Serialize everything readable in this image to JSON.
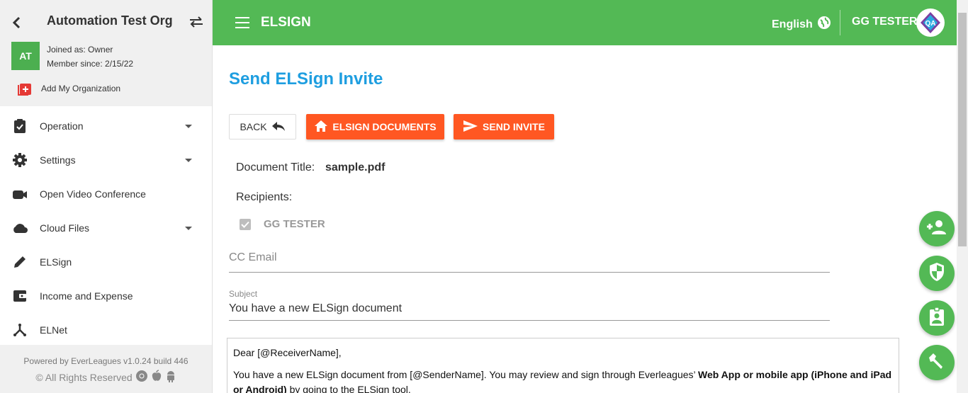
{
  "sidebar": {
    "org_name": "Automation Test Org",
    "avatar_initials": "AT",
    "joined_as": "Joined as: Owner",
    "member_since": "Member since: 2/15/22",
    "add_org_label": "Add My Organization",
    "items": [
      {
        "label": "Operation",
        "icon": "clipboard-check-icon",
        "has_caret": true
      },
      {
        "label": "Settings",
        "icon": "gear-icon",
        "has_caret": true
      },
      {
        "label": "Open Video Conference",
        "icon": "video-camera-icon",
        "has_caret": false
      },
      {
        "label": "Cloud Files",
        "icon": "cloud-icon",
        "has_caret": true
      },
      {
        "label": "ELSign",
        "icon": "pencil-icon",
        "has_caret": false
      },
      {
        "label": "Income and Expense",
        "icon": "wallet-icon",
        "has_caret": false
      },
      {
        "label": "ELNet",
        "icon": "network-icon",
        "has_caret": false
      }
    ],
    "footer": {
      "powered_by": "Powered by EverLeagues v1.0.24 build 446",
      "rights": "© All Rights Reserved"
    }
  },
  "topbar": {
    "app_title": "ELSIGN",
    "language": "English",
    "user_name": "GG TESTER",
    "user_avatar_text": "QA"
  },
  "main": {
    "title": "Send ELSign Invite",
    "buttons": {
      "back": "BACK",
      "documents": "ELSIGN DOCUMENTS",
      "send": "SEND INVITE"
    },
    "document_title_label": "Document Title:",
    "document_title_value": "sample.pdf",
    "recipients_label": "Recipients:",
    "recipients": [
      {
        "name": "GG TESTER",
        "checked": true
      }
    ],
    "cc_email_placeholder": "CC Email",
    "cc_email_value": "",
    "subject_label": "Subject",
    "subject_value": "You have a new ELSign document",
    "body": {
      "greeting": "Dear [@ReceiverName],",
      "line_start": "You have a new ELSign document from [@SenderName]. You may review and sign through Everleagues’ ",
      "line_bold1": "Web App or mobile app (iPhone and iPad or Android)",
      "line_end": " by going to the ELSign tool."
    }
  },
  "colors": {
    "green": "#53b955",
    "orange": "#ff5722",
    "blue_title": "#1e9ee0"
  }
}
